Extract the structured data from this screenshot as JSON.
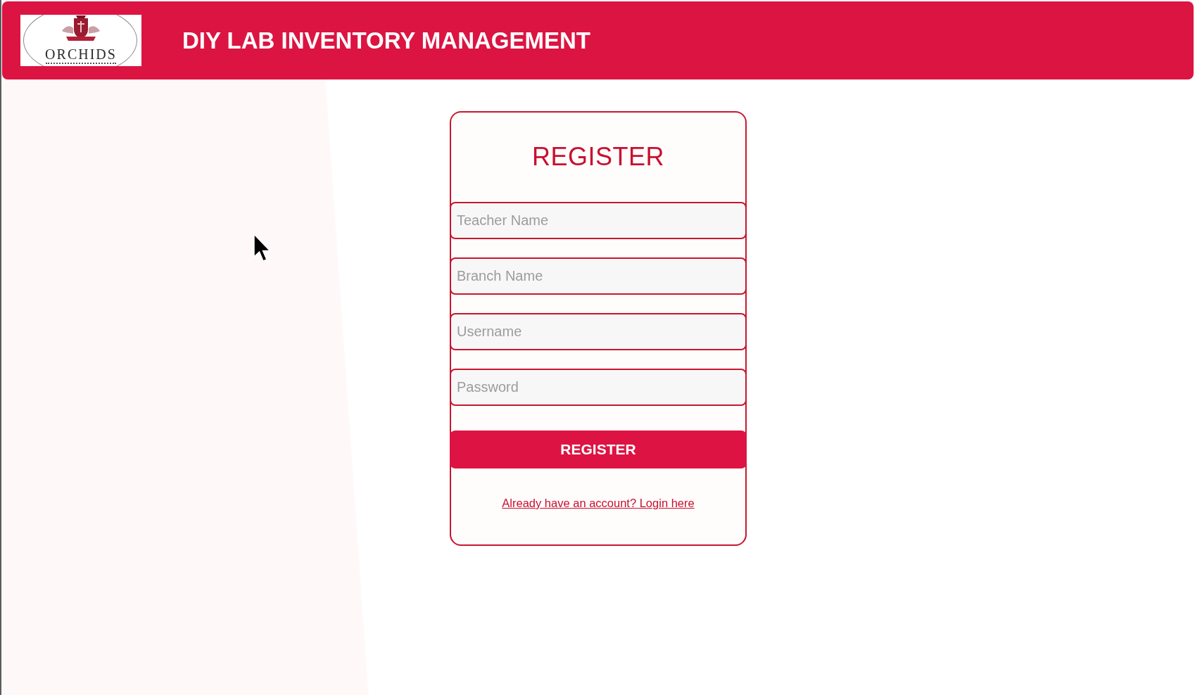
{
  "header": {
    "logo": {
      "text": "ORCHIDS"
    },
    "title": "DIY LAB INVENTORY MANAGEMENT"
  },
  "register_form": {
    "title": "REGISTER",
    "fields": [
      {
        "placeholder": "Teacher Name"
      },
      {
        "placeholder": "Branch Name"
      },
      {
        "placeholder": "Username"
      },
      {
        "placeholder": "Password"
      }
    ],
    "submit_button": "REGISTER",
    "login_link": "Already have an account? Login here"
  }
}
